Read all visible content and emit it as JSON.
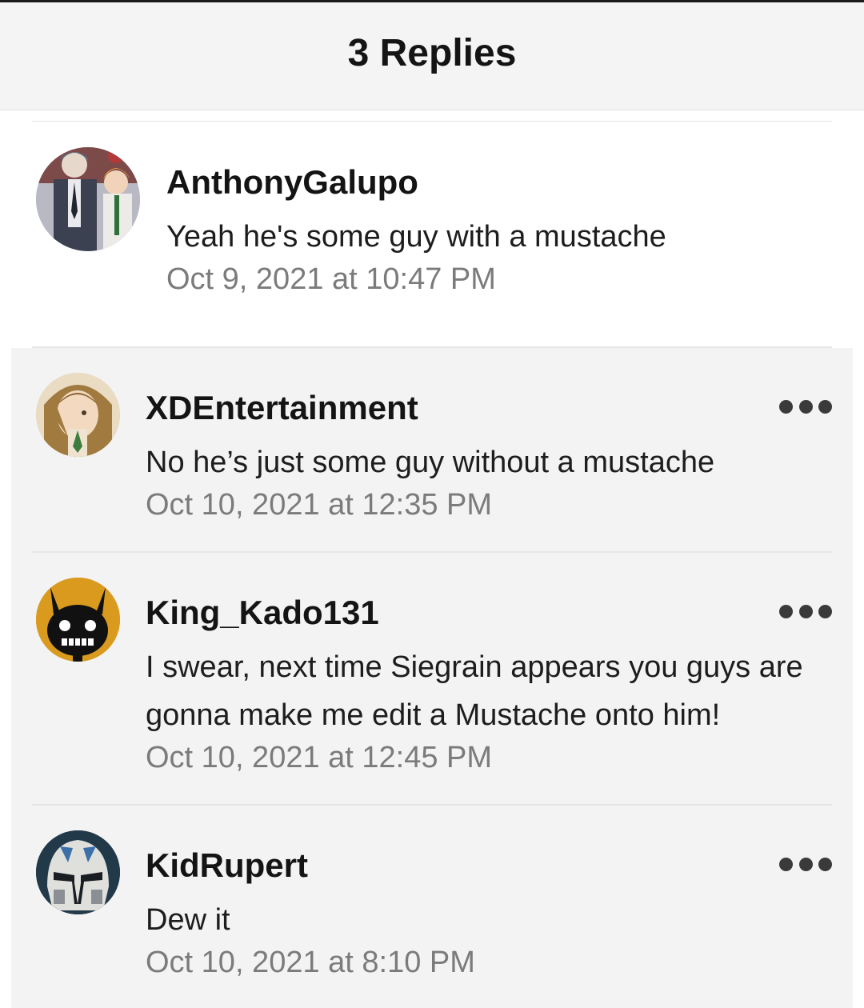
{
  "header": {
    "title": "3 Replies"
  },
  "parent_comment": {
    "username": "AnthonyGalupo",
    "text": "Yeah he's some guy with a mustache",
    "timestamp": "Oct 9, 2021 at 10:47 PM",
    "avatar_icon": "anime-characters-avatar"
  },
  "replies": [
    {
      "username": "XDEntertainment",
      "text": "No he’s just some guy without a mustache",
      "timestamp": "Oct 10, 2021 at 12:35 PM",
      "avatar_icon": "anime-girl-avatar",
      "more_icon": "more-options-icon"
    },
    {
      "username": "King_Kado131",
      "text_lines": [
        "I swear, next time Siegrain appears you guys are",
        "gonna make me edit a Mustache onto him!"
      ],
      "timestamp": "Oct 10, 2021 at 12:45 PM",
      "avatar_icon": "horned-skull-avatar",
      "more_icon": "more-options-icon"
    },
    {
      "username": "KidRupert",
      "text": "Dew it",
      "timestamp": "Oct 10, 2021 at 8:10 PM",
      "avatar_icon": "clone-trooper-helmet-avatar",
      "more_icon": "more-options-icon"
    }
  ],
  "colors": {
    "header_bg": "#f4f4f4",
    "reply_bg": "#f3f3f3",
    "timestamp": "#7b7b7b",
    "avatar_orange": "#d99a1e"
  }
}
